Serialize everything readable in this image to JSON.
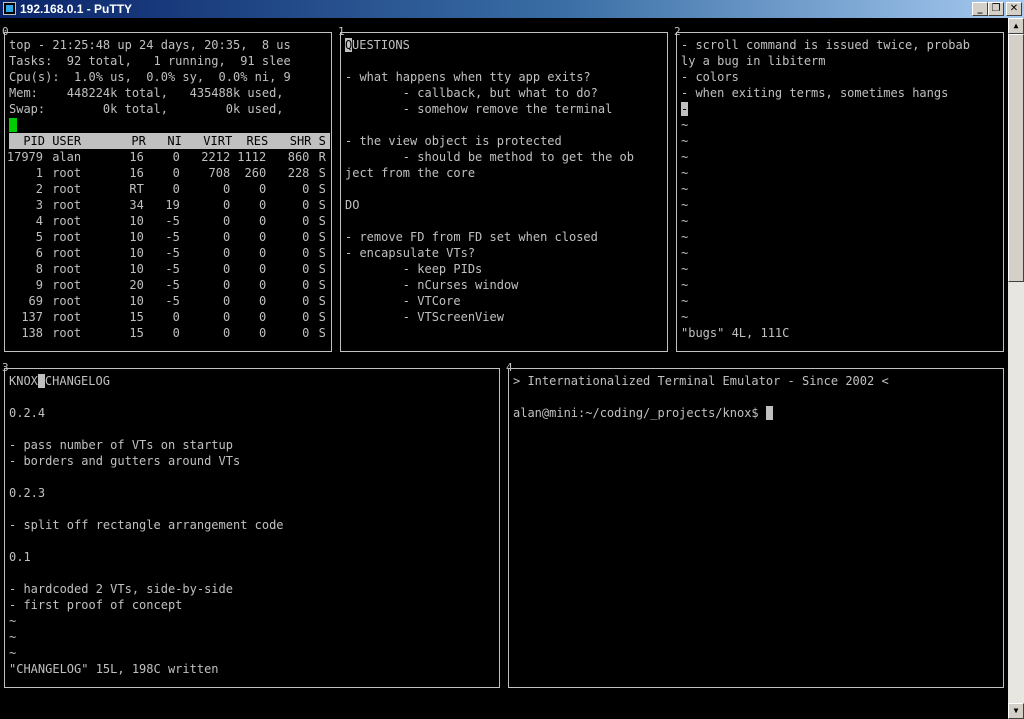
{
  "window": {
    "title": "192.168.0.1 - PuTTY",
    "minimize_glyph": "_",
    "maximize_glyph": "❐",
    "close_glyph": "✕"
  },
  "scrollbar": {
    "up_glyph": "▲",
    "down_glyph": "▼"
  },
  "vt0": {
    "number": "0",
    "summary": [
      "top - 21:25:48 up 24 days, 20:35,  8 us",
      "Tasks:  92 total,   1 running,  91 slee",
      "Cpu(s):  1.0% us,  0.0% sy,  0.0% ni, 9",
      "Mem:    448224k total,   435488k used,",
      "Swap:        0k total,        0k used,"
    ],
    "columns": [
      "PID",
      "USER",
      "PR",
      "NI",
      "VIRT",
      "RES",
      "SHR",
      "S"
    ],
    "processes": [
      {
        "pid": "17979",
        "user": "alan",
        "pr": "16",
        "ni": "0",
        "virt": "2212",
        "res": "1112",
        "shr": "860",
        "s": "R"
      },
      {
        "pid": "1",
        "user": "root",
        "pr": "16",
        "ni": "0",
        "virt": "708",
        "res": "260",
        "shr": "228",
        "s": "S"
      },
      {
        "pid": "2",
        "user": "root",
        "pr": "RT",
        "ni": "0",
        "virt": "0",
        "res": "0",
        "shr": "0",
        "s": "S"
      },
      {
        "pid": "3",
        "user": "root",
        "pr": "34",
        "ni": "19",
        "virt": "0",
        "res": "0",
        "shr": "0",
        "s": "S"
      },
      {
        "pid": "4",
        "user": "root",
        "pr": "10",
        "ni": "-5",
        "virt": "0",
        "res": "0",
        "shr": "0",
        "s": "S"
      },
      {
        "pid": "5",
        "user": "root",
        "pr": "10",
        "ni": "-5",
        "virt": "0",
        "res": "0",
        "shr": "0",
        "s": "S"
      },
      {
        "pid": "6",
        "user": "root",
        "pr": "10",
        "ni": "-5",
        "virt": "0",
        "res": "0",
        "shr": "0",
        "s": "S"
      },
      {
        "pid": "8",
        "user": "root",
        "pr": "10",
        "ni": "-5",
        "virt": "0",
        "res": "0",
        "shr": "0",
        "s": "S"
      },
      {
        "pid": "9",
        "user": "root",
        "pr": "20",
        "ni": "-5",
        "virt": "0",
        "res": "0",
        "shr": "0",
        "s": "S"
      },
      {
        "pid": "69",
        "user": "root",
        "pr": "10",
        "ni": "-5",
        "virt": "0",
        "res": "0",
        "shr": "0",
        "s": "S"
      },
      {
        "pid": "137",
        "user": "root",
        "pr": "15",
        "ni": "0",
        "virt": "0",
        "res": "0",
        "shr": "0",
        "s": "S"
      },
      {
        "pid": "138",
        "user": "root",
        "pr": "15",
        "ni": "0",
        "virt": "0",
        "res": "0",
        "shr": "0",
        "s": "S"
      }
    ]
  },
  "vt1": {
    "number": "1",
    "cursor_char": "Q",
    "first_line_rest": "UESTIONS",
    "lines": [
      "",
      "- what happens when tty app exits?",
      "        - callback, but what to do?",
      "        - somehow remove the terminal",
      "",
      "- the view object is protected",
      "        - should be method to get the ob",
      "ject from the core",
      "",
      "DO",
      "",
      "- remove FD from FD set when closed",
      "- encapsulate VTs?",
      "        - keep PIDs",
      "        - nCurses window",
      "        - VTCore",
      "        - VTScreenView"
    ]
  },
  "vt2": {
    "number": "2",
    "lines": [
      "- scroll command is issued twice, probab",
      "ly a bug in libiterm",
      "- colors",
      "- when exiting terms, sometimes hangs"
    ],
    "cursor_char": "-",
    "tildes": [
      "~",
      "~",
      "~",
      "~",
      "~",
      "~",
      "~",
      "~",
      "~",
      "~",
      "~",
      "~",
      "~"
    ],
    "status": "\"bugs\" 4L, 111C"
  },
  "vt3": {
    "number": "3",
    "title_before": "KNOX",
    "title_after": "CHANGELOG",
    "lines": [
      "",
      "0.2.4",
      "",
      "- pass number of VTs on startup",
      "- borders and gutters around VTs",
      "",
      "0.2.3",
      "",
      "- split off rectangle arrangement code",
      "",
      "0.1",
      "",
      "- hardcoded 2 VTs, side-by-side",
      "- first proof of concept",
      "~",
      "~",
      "~"
    ],
    "status": "\"CHANGELOG\" 15L, 198C written"
  },
  "vt4": {
    "number": "4",
    "banner": "> Internationalized Terminal Emulator - Since 2002 <",
    "prompt": "alan@mini:~/coding/_projects/knox$ "
  }
}
